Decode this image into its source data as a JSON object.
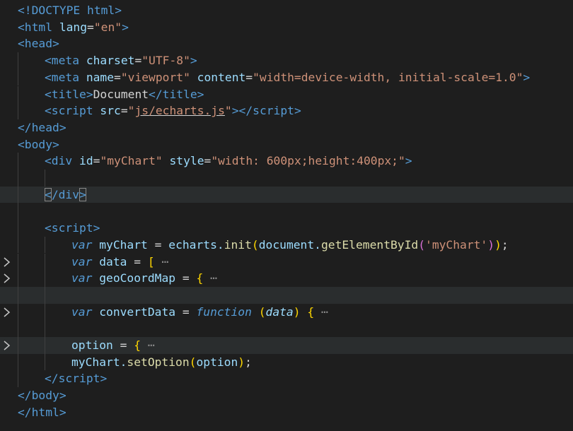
{
  "editor": {
    "language": "html",
    "theme_colors": {
      "background": "#1e1e1e",
      "tag": "#569cd6",
      "attribute": "#9cdcfe",
      "string": "#ce9178",
      "function": "#dcdcaa"
    },
    "lines": {
      "l1": {
        "t1": "<!DOCTYPE html>"
      },
      "l2": {
        "t1": "<html",
        "t2": " lang",
        "t3": "=",
        "t4": "\"en\"",
        "t5": ">"
      },
      "l3": {
        "t1": "<head>"
      },
      "l4": {
        "t1": "<meta",
        "t2": " charset",
        "t3": "=",
        "t4": "\"UTF-8\"",
        "t5": ">"
      },
      "l5": {
        "t1": "<meta",
        "t2": " name",
        "t3": "=",
        "t4": "\"viewport\"",
        "t5": " content",
        "t6": "=",
        "t7": "\"width=device-width, initial-scale=1.0\"",
        "t8": ">"
      },
      "l6": {
        "t1": "<title>",
        "t2": "Document",
        "t3": "</title>"
      },
      "l7": {
        "t1": "<script",
        "t2": " src",
        "t3": "=",
        "t4": "\"",
        "t5": "js/echarts.js",
        "t6": "\"",
        "t7": "></",
        "t8": "script",
        "t9": ">"
      },
      "l8": {
        "t1": "</head>"
      },
      "l9": {
        "t1": "<body>"
      },
      "l10": {
        "t1": "<div",
        "t2": " id",
        "t3": "=",
        "t4": "\"myChart\"",
        "t5": " style",
        "t6": "=",
        "t7": "\"width: 600px;height:400px;\"",
        "t8": ">"
      },
      "l12": {
        "t1": "<",
        "t2": "/div",
        "t3": ">"
      },
      "l14": {
        "t1": "<script>"
      },
      "l15": {
        "t1": "var",
        "t2": " myChart ",
        "t3": "=",
        "t4": " echarts.",
        "t5": "init",
        "t6": "(",
        "t7": "document.",
        "t8": "getElementById",
        "t9": "(",
        "t10": "'myChart'",
        "t11": ")",
        "t12": ")",
        "t13": ";"
      },
      "l16": {
        "t1": "var",
        "t2": " data ",
        "t3": "=",
        "t4": " [",
        "t5": " ⋯"
      },
      "l17": {
        "t1": "var",
        "t2": " geoCoordMap ",
        "t3": "=",
        "t4": " {",
        "t5": " ⋯"
      },
      "l19": {
        "t1": "var",
        "t2": " convertData ",
        "t3": "=",
        "t4": " function",
        "t5": " (",
        "t6": "data",
        "t7": ")",
        "t8": " {",
        "t9": " ⋯"
      },
      "l21": {
        "t1": "option",
        "t2": " = ",
        "t3": "{",
        "t4": " ⋯"
      },
      "l22": {
        "t1": "myChart.",
        "t2": "setOption",
        "t3": "(",
        "t4": "option",
        "t5": ")",
        "t6": ";"
      },
      "l23": {
        "t1": "</",
        "t2": "script",
        "t3": ">"
      },
      "l24": {
        "t1": "</body>"
      },
      "l25": {
        "t1": "</html>"
      }
    }
  }
}
